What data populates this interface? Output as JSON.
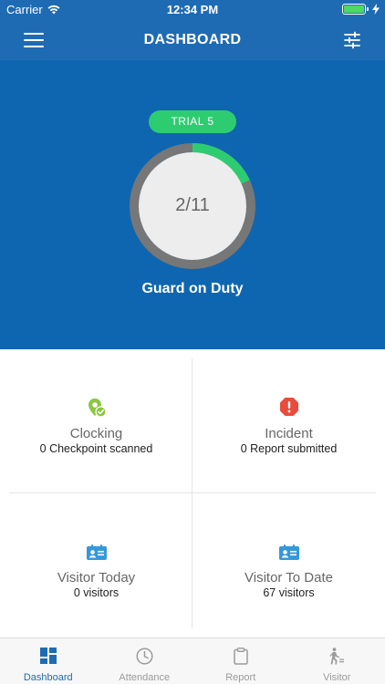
{
  "status_bar": {
    "carrier": "Carrier",
    "time": "12:34 PM"
  },
  "header": {
    "title": "DASHBOARD"
  },
  "hero": {
    "badge": "TRIAL 5",
    "gauge_value": "2/11",
    "gauge_on_duty": 2,
    "gauge_total": 11,
    "label": "Guard on Duty"
  },
  "stats": {
    "clocking": {
      "title": "Clocking",
      "subtitle": "0 Checkpoint scanned"
    },
    "incident": {
      "title": "Incident",
      "subtitle": "0 Report submitted"
    },
    "visitor_today": {
      "title": "Visitor Today",
      "subtitle": "0 visitors"
    },
    "visitor_to_date": {
      "title": "Visitor To Date",
      "subtitle": "67 visitors"
    }
  },
  "tabs": [
    {
      "label": "Dashboard",
      "icon": "dashboard-icon",
      "active": true
    },
    {
      "label": "Attendance",
      "icon": "clock-icon",
      "active": false
    },
    {
      "label": "Report",
      "icon": "clipboard-icon",
      "active": false
    },
    {
      "label": "Visitor",
      "icon": "walking-person-icon",
      "active": false
    }
  ],
  "colors": {
    "header": "#1f6bb3",
    "hero": "#0f66b0",
    "badge": "#2ecc71",
    "gauge_track": "#777777",
    "gauge_fill": "#2ecc71",
    "incident": "#e74c3c",
    "visitor_icon": "#3498db"
  }
}
